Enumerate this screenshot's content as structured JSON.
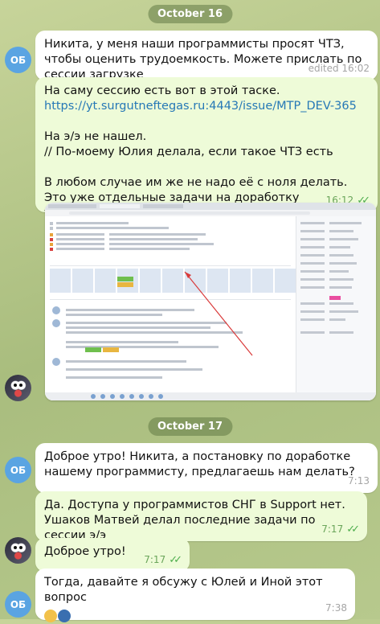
{
  "dates": [
    "October 16",
    "October 17"
  ],
  "avatars": {
    "ob": "ОБ"
  },
  "messages": [
    {
      "text": "Никита, у меня наши программисты просят ЧТЗ, чтобы оценить трудоемкость. Можете прислать по сессии загрузке",
      "time": "edited 16:02"
    },
    {
      "line1": "На саму сессию есть вот в этой таске.",
      "link": "https://yt.surgutneftegas.ru:4443/issue/MTP_DEV-365",
      "line2": "На э/э не нашел.",
      "line3": "// По-моему Юлия делала, если такое ЧТЗ есть",
      "line4": "В любом случае им же не надо её с ноля делать.",
      "line5": "Это уже отдельные задачи на доработку уточняющие",
      "time": "16:12"
    },
    {
      "text": "Доброе утро! Никита, а постановку по доработке нашему программисту, предлагаешь нам делать?",
      "time": "7:13"
    },
    {
      "text": "Да. Доступа у программистов СНГ в Support нет. Ушаков Матвей делал последние задачи по сессии э/э",
      "time": "7:17"
    },
    {
      "text": "Доброе утро!",
      "time": "7:17"
    },
    {
      "text": "Тогда, давайте я обсужу с Юлей и Иной этот вопрос",
      "time": "7:38"
    }
  ],
  "colors": {
    "incoming": "#ffffff",
    "outgoing": "#eefbd8",
    "accent_link": "#2678b6",
    "avatar_ob": "#5aa4e2"
  }
}
